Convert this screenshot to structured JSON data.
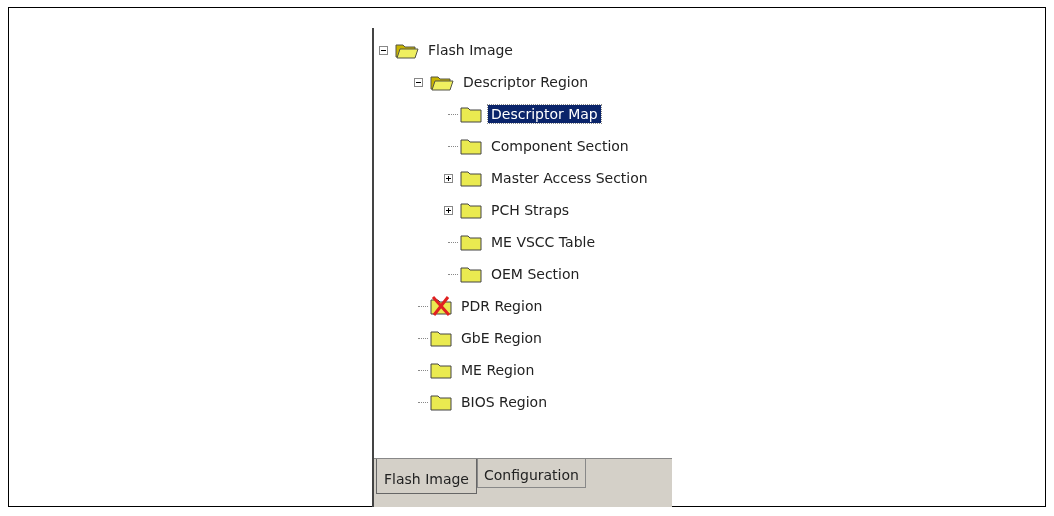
{
  "tree": [
    {
      "label": "Flash Image",
      "kind": "folder-open",
      "expanded": true,
      "selected": false,
      "children": [
        {
          "label": "Descriptor Region",
          "kind": "folder-open",
          "expanded": true,
          "selected": false,
          "children": [
            {
              "label": "Descriptor Map",
              "kind": "folder",
              "selected": true
            },
            {
              "label": "Component Section",
              "kind": "folder",
              "selected": false
            },
            {
              "label": "Master Access Section",
              "kind": "folder",
              "expanded": false,
              "selected": false
            },
            {
              "label": "PCH Straps",
              "kind": "folder",
              "expanded": false,
              "selected": false
            },
            {
              "label": "ME VSCC Table",
              "kind": "folder",
              "selected": false
            },
            {
              "label": "OEM Section",
              "kind": "folder",
              "selected": false
            }
          ]
        },
        {
          "label": "PDR Region",
          "kind": "error",
          "selected": false
        },
        {
          "label": "GbE Region",
          "kind": "folder",
          "selected": false
        },
        {
          "label": "ME Region",
          "kind": "folder",
          "selected": false
        },
        {
          "label": "BIOS Region",
          "kind": "folder",
          "selected": false
        }
      ]
    }
  ],
  "tabs": [
    {
      "label": "Flash Image",
      "selected": true
    },
    {
      "label": "Configuration",
      "selected": false
    }
  ]
}
